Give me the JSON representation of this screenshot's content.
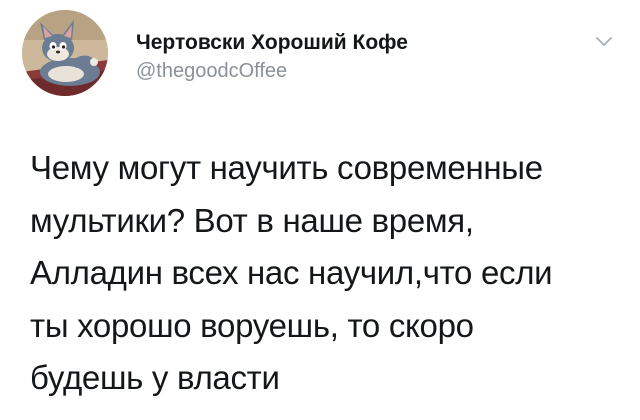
{
  "tweet": {
    "author": {
      "display_name": "Чертовски Хороший Кофе",
      "handle": "@thegoodcOffee",
      "avatar_icon": "cartoon-cat-avatar"
    },
    "menu_icon": "chevron-down-icon",
    "text_lines": [
      "Чему могут научить современные",
      "мультики? Вот в наше время,",
      "Алладин всех нас научил,что если",
      "ты хорошо воруешь, то скоро",
      "будешь у власти"
    ],
    "colors": {
      "text": "#14171a",
      "secondary": "#8a9199",
      "background": "#ffffff"
    }
  }
}
